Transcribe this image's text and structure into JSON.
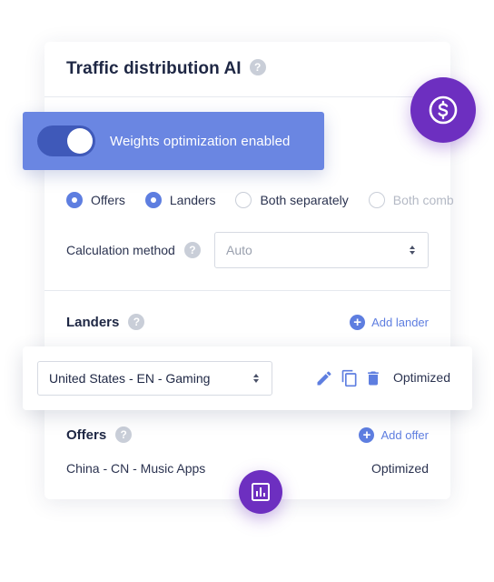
{
  "panel": {
    "title": "Traffic distribution AI",
    "help_glyph": "?"
  },
  "banner": {
    "toggle_on": true,
    "label": "Weights optimization enabled"
  },
  "optimize_targets": [
    {
      "label": "Offers",
      "checked": true
    },
    {
      "label": "Landers",
      "checked": true
    },
    {
      "label": "Both separately",
      "checked": false
    },
    {
      "label": "Both comb",
      "checked": false
    }
  ],
  "calculation": {
    "label": "Calculation method",
    "value": "Auto"
  },
  "landers": {
    "title": "Landers",
    "add_label": "Add lander",
    "row": {
      "selected": "United States - EN - Gaming",
      "status": "Optimized"
    }
  },
  "offers": {
    "title": "Offers",
    "add_label": "Add offer",
    "row": {
      "name": "China - CN - Music Apps",
      "status": "Optimized"
    }
  },
  "colors": {
    "accent": "#5e7ee0",
    "banner": "#6a86e2",
    "toggle_track": "#3f59b9",
    "purple": "#6d2fc0"
  },
  "icons": {
    "dollar": "dollar-circle-icon",
    "chart": "bar-chart-icon",
    "edit": "pencil-icon",
    "copy": "copy-icon",
    "delete": "trash-icon"
  }
}
